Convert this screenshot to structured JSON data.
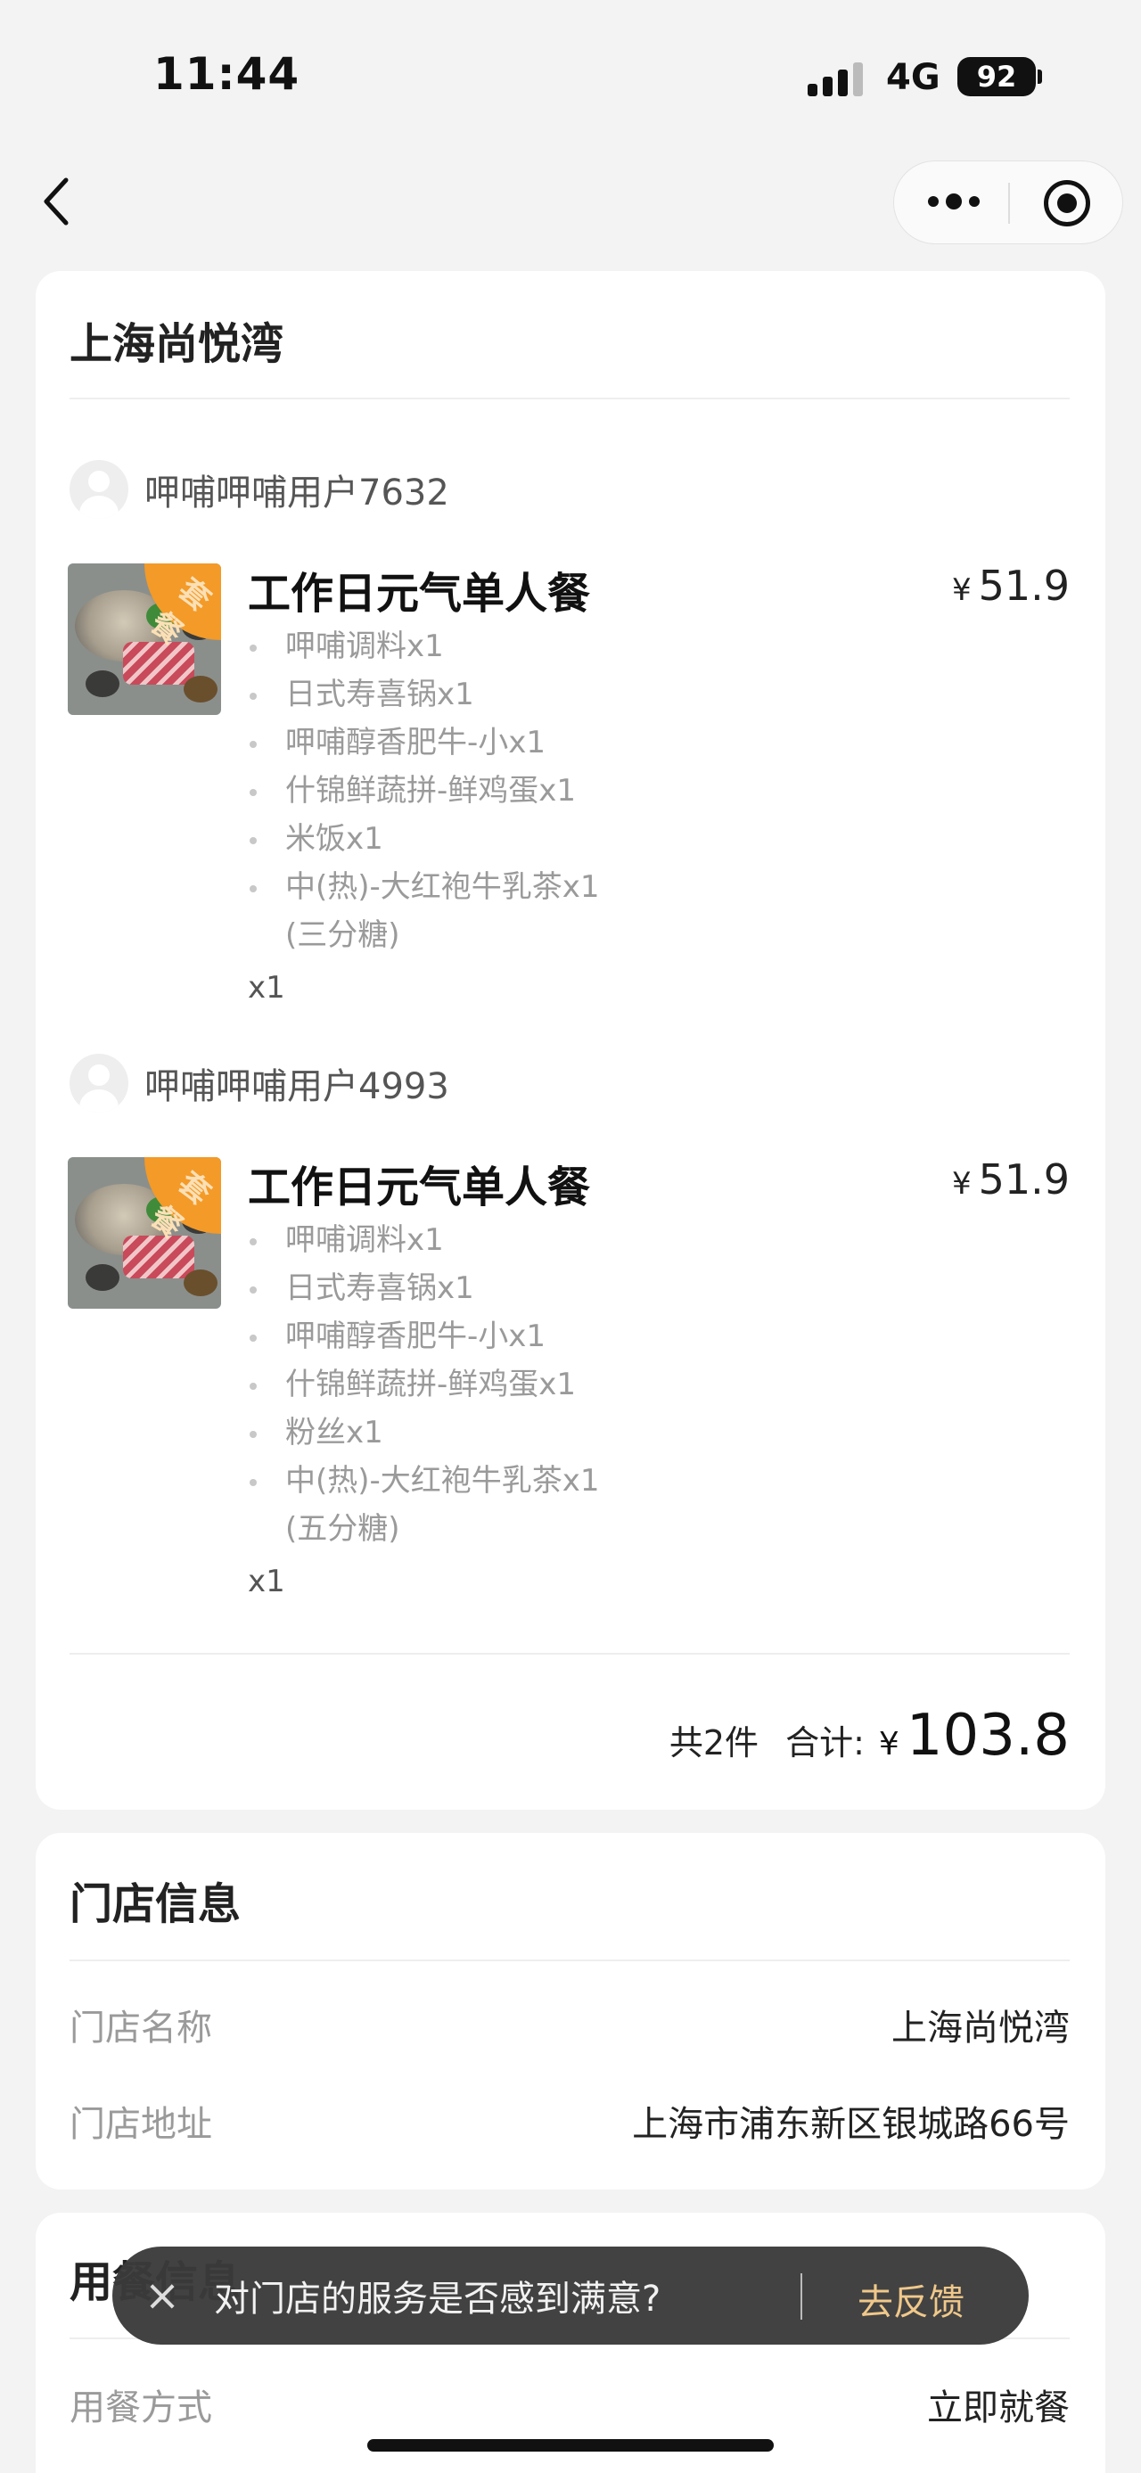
{
  "status_bar": {
    "time": "11:44",
    "network": "4G",
    "battery": "92"
  },
  "nav": {
    "back_icon": "chevron-left-icon",
    "more_icon": "more-dots-icon",
    "close_icon": "target-circle-icon"
  },
  "order": {
    "store_title": "上海尚悦湾",
    "entries": [
      {
        "user": "呷哺呷哺用户7632",
        "badge": "套餐",
        "name": "工作日元气单人餐",
        "currency": "¥",
        "price": "51.9",
        "items": [
          "呷哺调料x1",
          "日式寿喜锅x1",
          "呷哺醇香肥牛-小x1",
          "什锦鲜蔬拼-鲜鸡蛋x1",
          "米饭x1",
          "中(热)-大红袍牛乳茶x1",
          "(三分糖)"
        ],
        "qty": "x1"
      },
      {
        "user": "呷哺呷哺用户4993",
        "badge": "套餐",
        "name": "工作日元气单人餐",
        "currency": "¥",
        "price": "51.9",
        "items": [
          "呷哺调料x1",
          "日式寿喜锅x1",
          "呷哺醇香肥牛-小x1",
          "什锦鲜蔬拼-鲜鸡蛋x1",
          "粉丝x1",
          "中(热)-大红袍牛乳茶x1",
          "(五分糖)"
        ],
        "qty": "x1"
      }
    ],
    "total_count": "共2件",
    "total_label": "合计:",
    "total_currency": "¥",
    "total_amount": "103.8"
  },
  "store_info": {
    "title": "门店信息",
    "name_label": "门店名称",
    "name_value": "上海尚悦湾",
    "address_label": "门店地址",
    "address_value": "上海市浦东新区银城路66号"
  },
  "dining_info": {
    "title": "用餐信息",
    "mode_label": "用餐方式",
    "mode_value": "立即就餐"
  },
  "toast": {
    "close": "×",
    "message": "对门店的服务是否感到满意?",
    "action": "去反馈"
  }
}
